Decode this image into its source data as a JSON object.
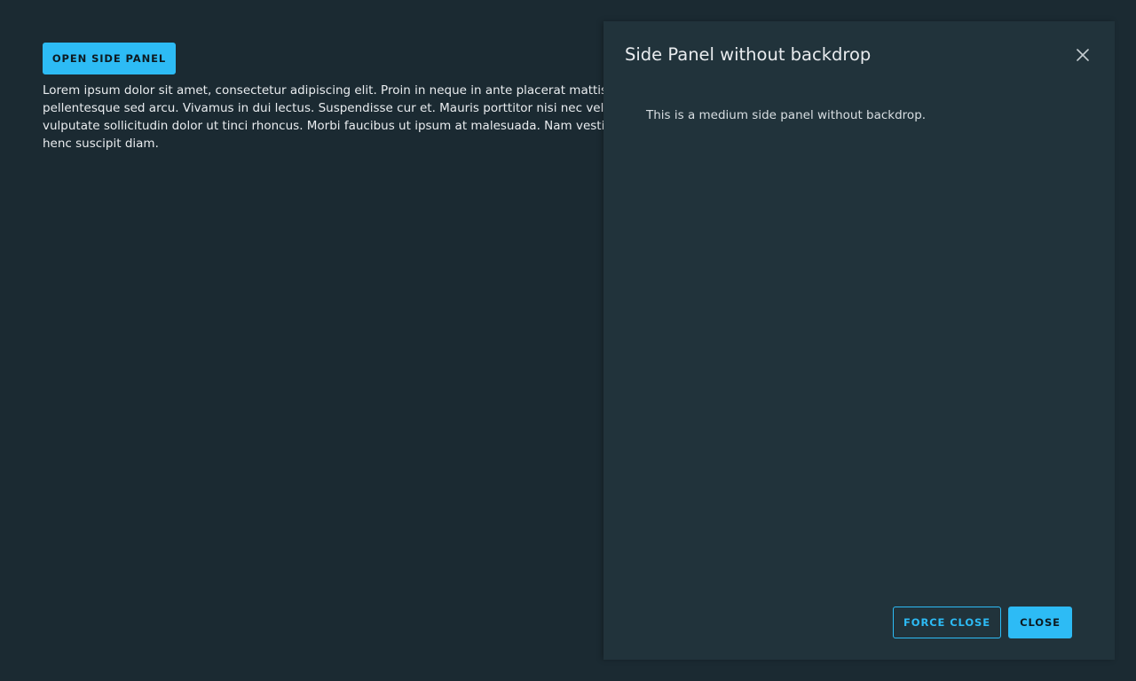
{
  "main": {
    "open_button_label": "OPEN SIDE PANEL",
    "paragraph": "Lorem ipsum dolor sit amet, consectetur adipiscing elit. Proin in neque in ante placerat mattis id pellentesque aliquet suscipit eget, pellentesque sed arcu. Vivamus in dui lectus. Suspendisse cur et. Mauris porttitor nisi nec velit pharetra porttitor. Vestibulum vulputate sollicitudin dolor ut tinci rhoncus. Morbi faucibus ut ipsum at malesuada. Nam vestibulum felis sit amet metus finibus henc suscipit diam."
  },
  "side_panel": {
    "title": "Side Panel without backdrop",
    "body_text": "This is a medium side panel without backdrop.",
    "close_icon": "close-icon",
    "force_close_label": "FORCE CLOSE",
    "close_label": "CLOSE"
  },
  "colors": {
    "background": "#1b2a32",
    "panel_background": "#21333b",
    "accent": "#2dbbf5",
    "text": "#e9ecef"
  }
}
